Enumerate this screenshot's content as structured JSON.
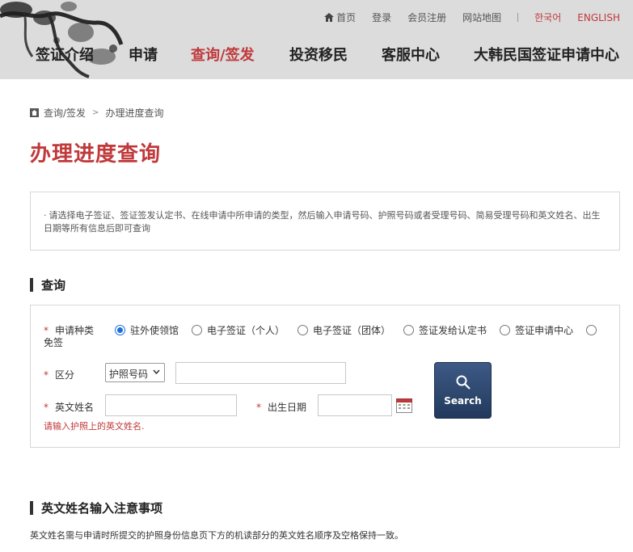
{
  "header": {
    "util": {
      "home": "首页",
      "login": "登录",
      "register": "会员注册",
      "sitemap": "网站地图",
      "korean": "한국어",
      "english": "ENGLISH"
    },
    "nav": [
      "签证介绍",
      "申请",
      "查询/签发",
      "投资移民",
      "客服中心",
      "大韩民国签证申请中心"
    ]
  },
  "breadcrumb": {
    "parent": "查询/签发",
    "sep": ">",
    "current": "办理进度查询"
  },
  "page_title": "办理进度查询",
  "notice": {
    "bullet": "·",
    "text": "请选择电子签证、签证签发认定书、在线申请中所申请的类型，然后输入申请号码、护照号码或者受理号码、简易受理号码和英文姓名、出生日期等所有信息后即可查询"
  },
  "query_section": {
    "title": "查询",
    "required_mark": "*",
    "apply_type": {
      "label": "申请种类",
      "options": [
        "驻外使领馆",
        "电子签证（个人）",
        "电子签证（团体）",
        "签证发给认定书",
        "签证申请中心",
        "免签"
      ],
      "selected": 0
    },
    "category": {
      "label": "区分",
      "selected": "护照号码",
      "value": ""
    },
    "english_name": {
      "label": "英文姓名",
      "value": ""
    },
    "birth_date": {
      "label": "出生日期",
      "value": ""
    },
    "search_button": "Search",
    "hint": "请输入护照上的英文姓名."
  },
  "name_notes": {
    "title": "英文姓名输入注意事项",
    "text": "英文姓名需与申请时所提交的护照身份信息页下方的机读部分的英文姓名顺序及空格保持一致。"
  },
  "colors": {
    "accent": "#c0393b",
    "header_bg": "#dcdcdc",
    "button": "#2b4468",
    "radio": "#1a6ed8"
  }
}
